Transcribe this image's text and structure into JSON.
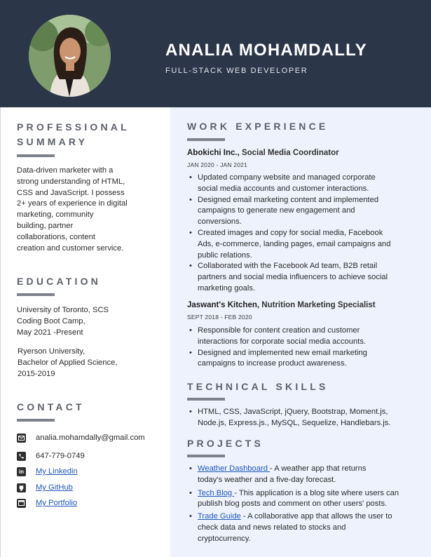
{
  "header": {
    "name": "ANALIA MOHAMDALLY",
    "title": "FULL-STACK WEB DEVELOPER"
  },
  "summary": {
    "heading_line1": "PROFESSIONAL",
    "heading_line2": "SUMMARY",
    "lines": [
      "Data-driven marketer with a",
      "strong understanding of HTML,",
      "CSS and JavaScript. I possess",
      "2+ years of experience in digital",
      "marketing, community",
      "building, partner",
      "collaborations, content",
      "creation and customer service."
    ]
  },
  "education": {
    "heading": "EDUCATION",
    "entry1": [
      "University of Toronto, SCS",
      "Coding Boot Camp,",
      "May 2021 -Present"
    ],
    "entry2": [
      "Ryerson University,",
      "Bachelor of Applied Science,",
      "2015-2019"
    ]
  },
  "contact": {
    "heading": "CONTACT",
    "email": "analia.mohamdally@gmail.com",
    "phone": "647-779-0749",
    "linkedin": "My Linkedin",
    "github": "My GitHub",
    "portfolio": "My Portfolio",
    "linkedin_glyph": "in"
  },
  "work": {
    "heading": "WORK EXPERIENCE",
    "jobs": [
      {
        "company": "Abokichi Inc.,",
        "role": " Social Media Coordinator",
        "dates": "JAN 2020 - JAN 2021",
        "bullets": [
          [
            "Updated company website and managed corporate",
            "social media accounts and customer interactions."
          ],
          [
            "Designed email marketing content and implemented",
            "campaigns to generate new engagement and",
            "conversions."
          ],
          [
            "Created images and copy for social media, Facebook",
            "Ads, e-commerce, landing pages, email campaigns and",
            "public relations."
          ],
          [
            "Collaborated with the Facebook Ad team, B2B retail",
            "partners and social media influencers to achieve social",
            "marketing goals."
          ]
        ]
      },
      {
        "company": "Jaswant's Kitchen",
        "role": ", Nutrition Marketing Specialist",
        "dates": "SEPT 2018 - FEB 2020",
        "bullets": [
          [
            "Responsible for content creation and customer",
            "interactions for corporate social media accounts."
          ],
          [
            "Designed and implemented new email marketing",
            "campaigns to increase product awareness."
          ]
        ]
      }
    ]
  },
  "skills": {
    "heading": "TECHNICAL SKILLS",
    "lines": [
      "HTML, CSS, JavaScript, jQuery, Bootstrap, Moment.js,",
      "Node.js, Express.js., MySQL, Sequelize, Handlebars.js."
    ]
  },
  "projects": {
    "heading": "PROJECTS",
    "items": [
      {
        "link": "Weather Dashboard ",
        "line1": "- A weather app that returns",
        "line2": "today's weather and a five-day forecast.",
        "line3": ""
      },
      {
        "link": "Tech Blog ",
        "line1": "- This application is a blog site where users can",
        "line2": "publish blog posts and comment on other users' posts.",
        "line3": ""
      },
      {
        "link": "Trade Guide",
        "line1": " - A collaborative app that allows the user to",
        "line2": "check data and news related to stocks and",
        "line3": "cryptocurrency."
      }
    ]
  },
  "colors": {
    "header_bg": "#2c3649",
    "right_bg": "#edf2fd",
    "link": "#1f58b8",
    "heading": "#5c6069"
  }
}
